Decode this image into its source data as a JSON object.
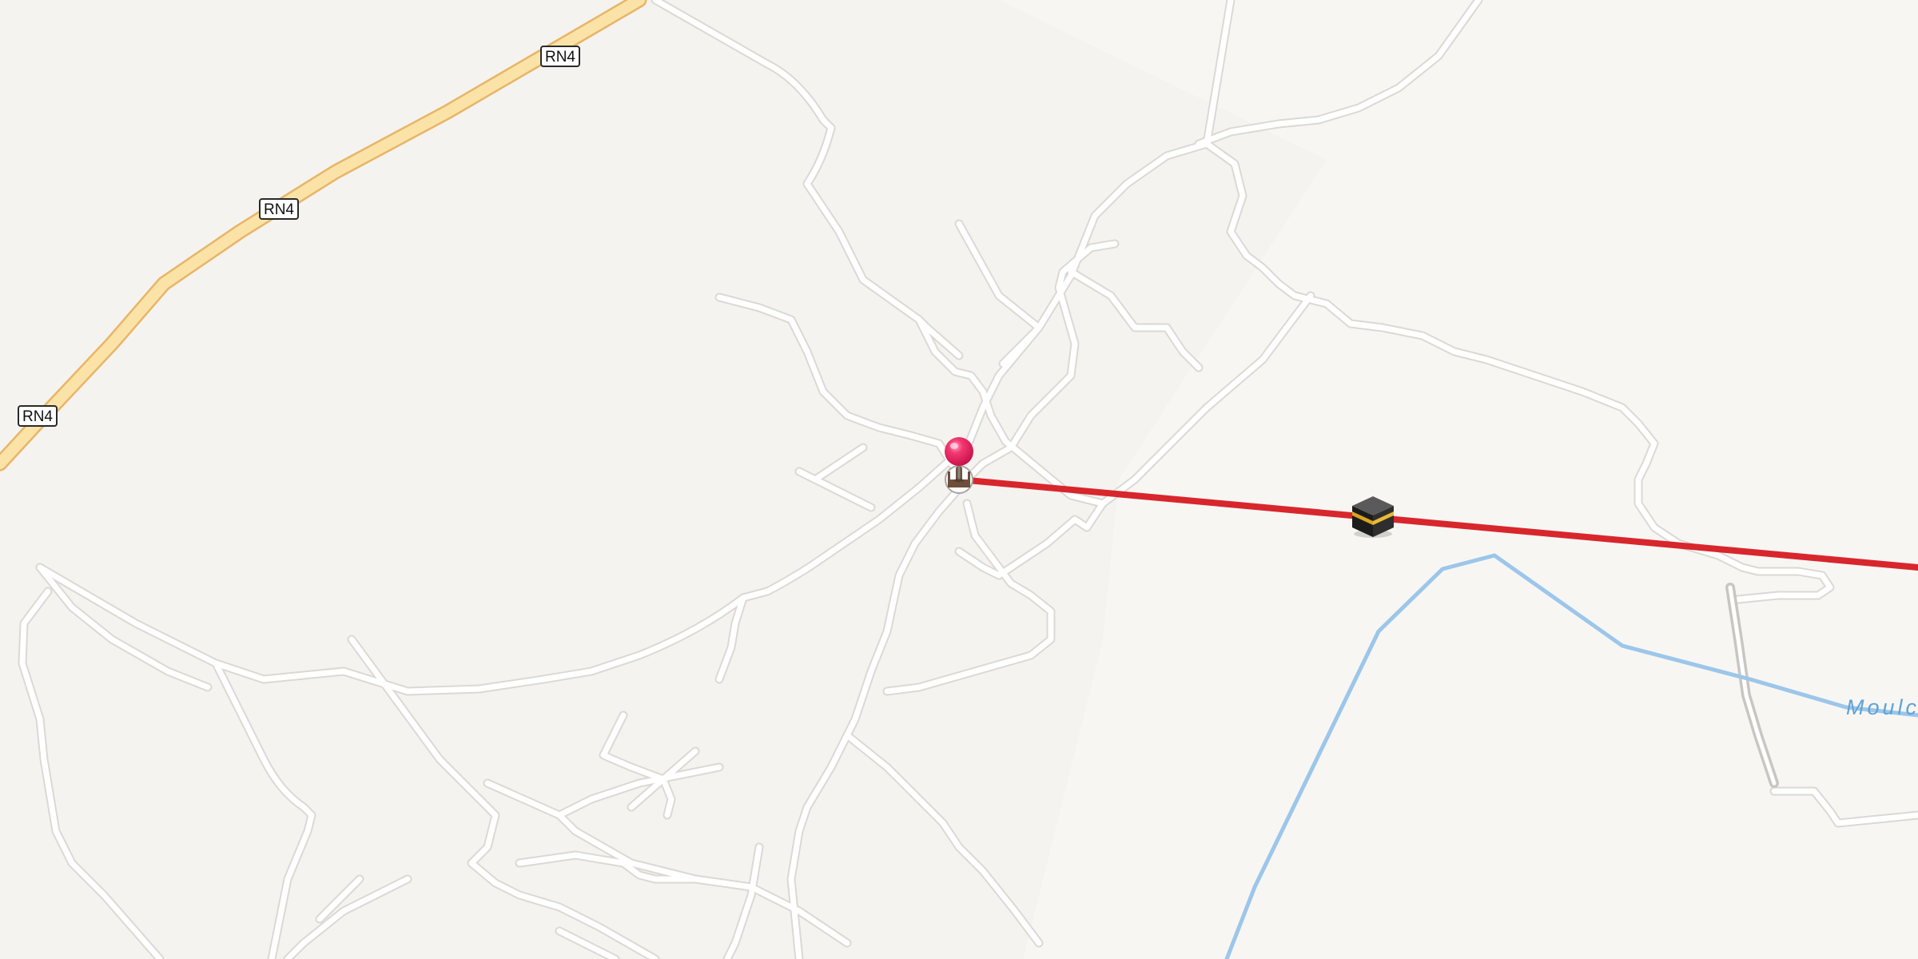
{
  "map": {
    "route_shields": [
      {
        "label": "RN4"
      },
      {
        "label": "RN4"
      },
      {
        "label": "RN4"
      }
    ],
    "water_label": "Moulc",
    "colors": {
      "background": "#f5f3f0",
      "road": "#ffffff",
      "highway": "#fbe3a8",
      "river": "#9cc6ea",
      "qibla_line": "#d8262d",
      "pin": "#e81f5c"
    },
    "icons": {
      "location_pin": "map-pin-icon",
      "mosque": "mosque-icon",
      "kaaba": "kaaba-icon"
    }
  }
}
